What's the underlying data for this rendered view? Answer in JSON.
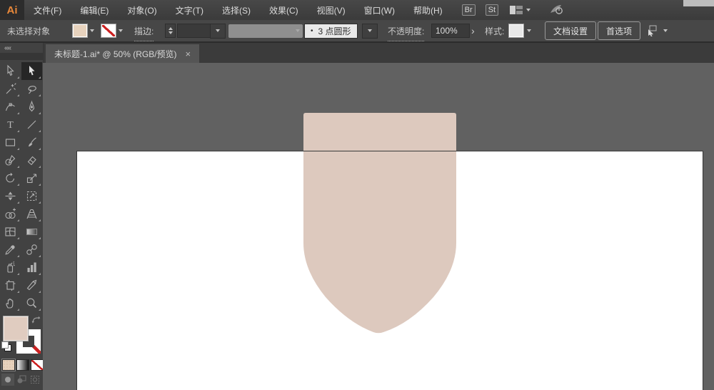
{
  "app": {
    "logo_text": "Ai",
    "logo_color": "#e8883a"
  },
  "menu": {
    "items": [
      "文件(F)",
      "编辑(E)",
      "对象(O)",
      "文字(T)",
      "选择(S)",
      "效果(C)",
      "视图(V)",
      "窗口(W)",
      "帮助(H)"
    ],
    "bridge_label": "Br",
    "stock_label": "St"
  },
  "control_bar": {
    "status_text": "未选择对象",
    "stroke_label": "描边:",
    "brush_bullet": "•",
    "brush_value": "3 点圆形",
    "opacity_label": "不透明度:",
    "opacity_value": "100%",
    "opacity_expand": "›",
    "style_label": "样式:",
    "doc_setup_button": "文档设置",
    "preferences_button": "首选项"
  },
  "tab": {
    "title": "未标题-1.ai* @ 50% (RGB/预览)",
    "close": "×"
  },
  "toolbar": {
    "collapse_glyph": "««",
    "tools": [
      "selection",
      "direct-selection",
      "magic-wand",
      "lasso",
      "curvature-pen",
      "pen",
      "type",
      "line-segment",
      "rectangle",
      "paintbrush",
      "pencil",
      "eraser",
      "rotate",
      "scale",
      "width",
      "free-transform",
      "shape-builder",
      "perspective-grid",
      "mesh",
      "gradient",
      "eyedropper",
      "blend",
      "symbol-sprayer",
      "column-graph",
      "artboard",
      "slice",
      "hand",
      "zoom"
    ],
    "active_tool": "direct-selection"
  },
  "colors": {
    "fill_swatch": "#e7d2bd",
    "canvas_shape": "#ddc9be",
    "pasteboard": "#616161",
    "artboard": "#ffffff",
    "none_slash": "#cc2222",
    "chrome_dark": "#3b3b3b"
  }
}
